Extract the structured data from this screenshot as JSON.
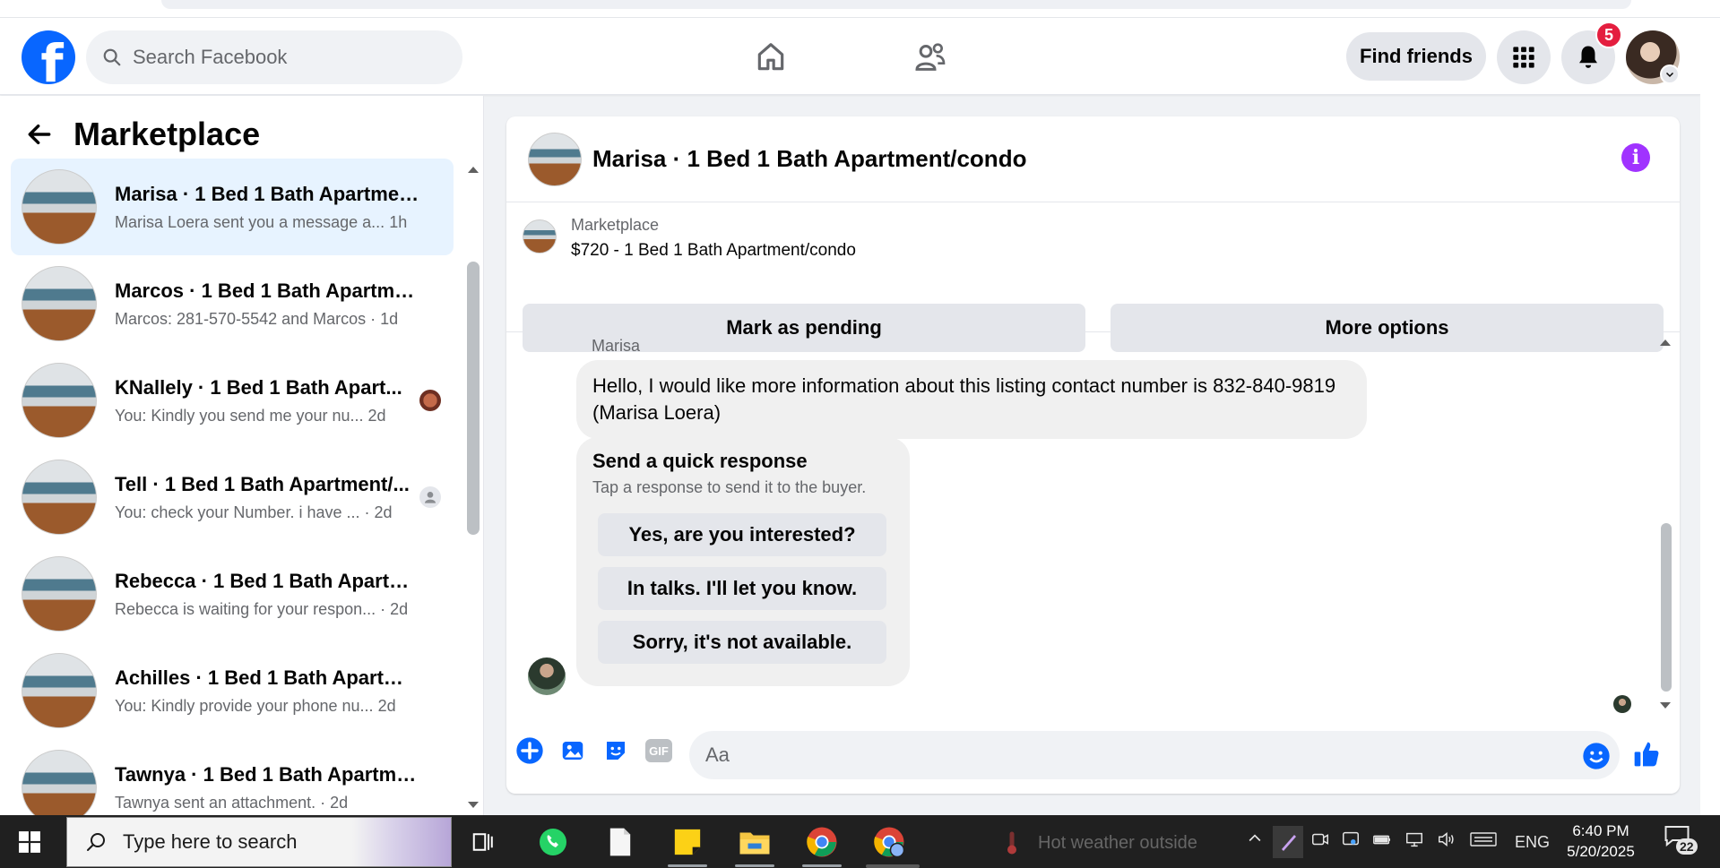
{
  "header": {
    "logo_letter": "f",
    "search_placeholder": "Search Facebook",
    "find_friends_label": "Find friends",
    "notification_count": "5"
  },
  "sidebar": {
    "title": "Marketplace",
    "threads": [
      {
        "name": "Marisa · 1 Bed 1 Bath Apartment...",
        "preview": "Marisa Loera sent you a message a...",
        "time": "1h",
        "active": true
      },
      {
        "name": "Marcos · 1 Bed 1 Bath Apartmen...",
        "preview": "Marcos: 281-570-5542 and Marcos",
        "time": "1d"
      },
      {
        "name": "KNallely · 1 Bed 1 Bath Apart...",
        "preview": "You: Kindly you send me your nu...",
        "time": "2d"
      },
      {
        "name": "Tell · 1 Bed 1 Bath Apartment/...",
        "preview": "You: check your Number. i have ...",
        "time": "2d"
      },
      {
        "name": "Rebecca · 1 Bed 1 Bath Apartme...",
        "preview": "Rebecca is waiting for your respon...",
        "time": "2d"
      },
      {
        "name": "Achilles · 1 Bed 1 Bath Apartmen...",
        "preview": "You: Kindly provide your phone nu...",
        "time": "2d"
      },
      {
        "name": "Tawnya · 1 Bed 1 Bath Apartmen...",
        "preview": "Tawnya sent an attachment.",
        "time": "2d"
      }
    ]
  },
  "chat": {
    "title": "Marisa · 1 Bed 1 Bath Apartment/condo",
    "listing_label": "Marketplace",
    "listing_price_title": "$720 - 1 Bed 1 Bath Apartment/condo",
    "mark_pending_label": "Mark as pending",
    "more_options_label": "More options",
    "sender_name": "Marisa",
    "message_text": "Hello, I would like more information about this listing contact number is 832-840-9819 (Marisa Loera)",
    "quick_response": {
      "title": "Send a quick response",
      "subtitle": "Tap a response to send it to the buyer.",
      "options": [
        "Yes, are you interested?",
        "In talks. I'll let you know.",
        "Sorry, it's not available."
      ]
    },
    "composer_placeholder": "Aa",
    "gif_label": "GIF"
  },
  "taskbar": {
    "search_placeholder": "Type here to search",
    "weather_text": "Hot weather outside",
    "language": "ENG",
    "time": "6:40 PM",
    "date": "5/20/2025",
    "notification_count": "22"
  },
  "colors": {
    "brand_blue": "#0866ff",
    "active_thread_bg": "#e7f3ff",
    "info_purple": "#a033ff",
    "badge_red": "#e41e3f"
  }
}
